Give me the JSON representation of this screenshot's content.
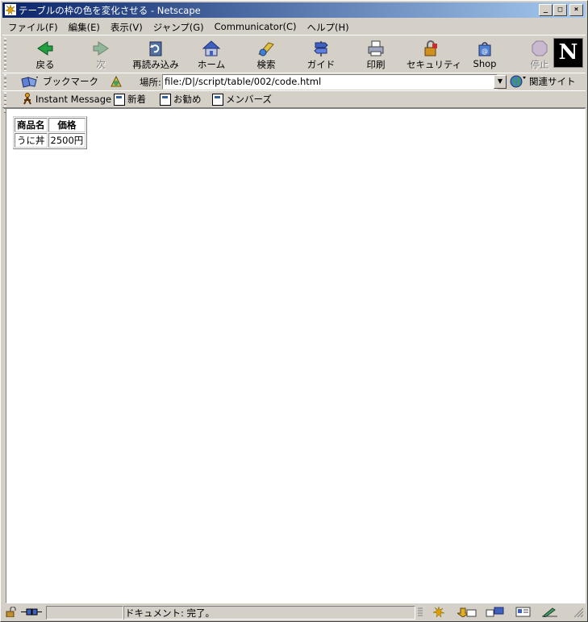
{
  "window": {
    "title": "テーブルの枠の色を変化させる - Netscape",
    "browser_logo": "N"
  },
  "menu": [
    {
      "label": "ファイル(F)"
    },
    {
      "label": "編集(E)"
    },
    {
      "label": "表示(V)"
    },
    {
      "label": "ジャンプ(G)"
    },
    {
      "label": "Communicator(C)"
    },
    {
      "label": "ヘルプ(H)"
    }
  ],
  "toolbar": {
    "back": "戻る",
    "forward": "次",
    "reload": "再読み込み",
    "home": "ホーム",
    "search": "検索",
    "guide": "ガイド",
    "print": "印刷",
    "security": "セキュリティ",
    "shop": "Shop",
    "stop": "停止"
  },
  "location": {
    "bookmarks": "ブックマーク",
    "label": "場所:",
    "url": "file:/D|/script/table/002/code.html",
    "related": "関連サイト"
  },
  "personal": {
    "instant_message": "Instant Message",
    "new": "新着",
    "recommend": "お勧め",
    "members": "メンバーズ"
  },
  "table": {
    "headers": [
      "商品名",
      "価格"
    ],
    "rows": [
      [
        "うに丼",
        "2500円"
      ]
    ]
  },
  "status": {
    "text": "ドキュメント: 完了。"
  }
}
